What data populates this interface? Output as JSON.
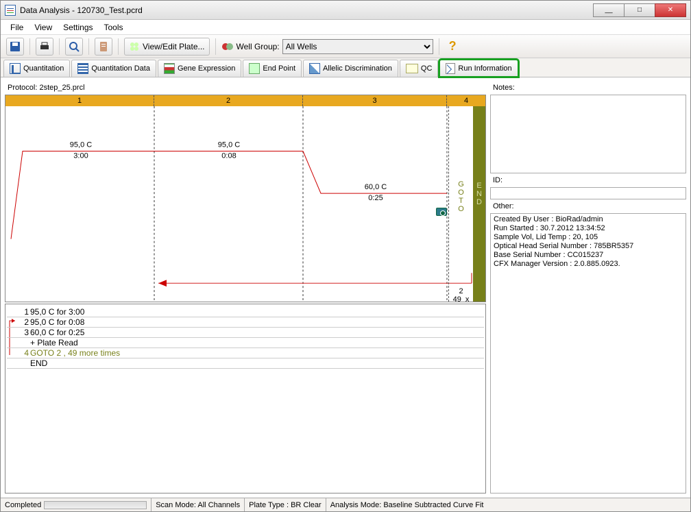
{
  "window": {
    "title": "Data Analysis - 120730_Test.pcrd"
  },
  "menu": {
    "file": "File",
    "view": "View",
    "settings": "Settings",
    "tools": "Tools"
  },
  "toolbar": {
    "viewedit": "View/Edit Plate...",
    "wellgroup_label": "Well Group:",
    "wellgroup_value": "All Wells"
  },
  "tabs": {
    "quant": "Quantitation",
    "quantdata": "Quantitation Data",
    "gene": "Gene Expression",
    "endpoint": "End Point",
    "allelic": "Allelic Discrimination",
    "qc": "QC",
    "runinfo": "Run Information"
  },
  "protocol": {
    "label": "Protocol: 2step_25.prcl",
    "step_headers": [
      "1",
      "2",
      "3",
      "4"
    ],
    "s1_temp": "95,0   C",
    "s1_time": "3:00",
    "s2_temp": "95,0   C",
    "s2_time": "0:08",
    "s3_temp": "60,0   C",
    "s3_time": "0:25",
    "goto_vert": "G O T O",
    "end_vert": "E N D",
    "goto_step": "2",
    "goto_cycles": "49",
    "goto_x": "x"
  },
  "steps": [
    {
      "n": "1",
      "text": "95,0   C  for  3:00"
    },
    {
      "n": "2",
      "text": "95,0   C  for  0:08"
    },
    {
      "n": "3",
      "text": "60,0   C  for  0:25"
    },
    {
      "n": "",
      "text": "+ Plate Read"
    },
    {
      "n": "4",
      "text": "GOTO   2  ,     49  more times",
      "goto": true
    },
    {
      "n": "",
      "text": "END"
    }
  ],
  "right": {
    "notes_label": "Notes:",
    "id_label": "ID:",
    "other_label": "Other:",
    "other_lines": {
      "l1": "Created By User : BioRad/admin",
      "l2": "Run Started : 30.7.2012 13:34:52",
      "l3": "Sample Vol, Lid Temp : 20, 105",
      "l4": "Optical Head Serial Number : 785BR5357",
      "l5": "Base Serial Number : CC015237",
      "l6": "CFX Manager Version : 2.0.885.0923."
    }
  },
  "status": {
    "completed": "Completed",
    "scan": "Scan Mode: All Channels",
    "plate": "Plate Type : BR Clear",
    "analysis": "Analysis Mode: Baseline Subtracted Curve Fit"
  }
}
